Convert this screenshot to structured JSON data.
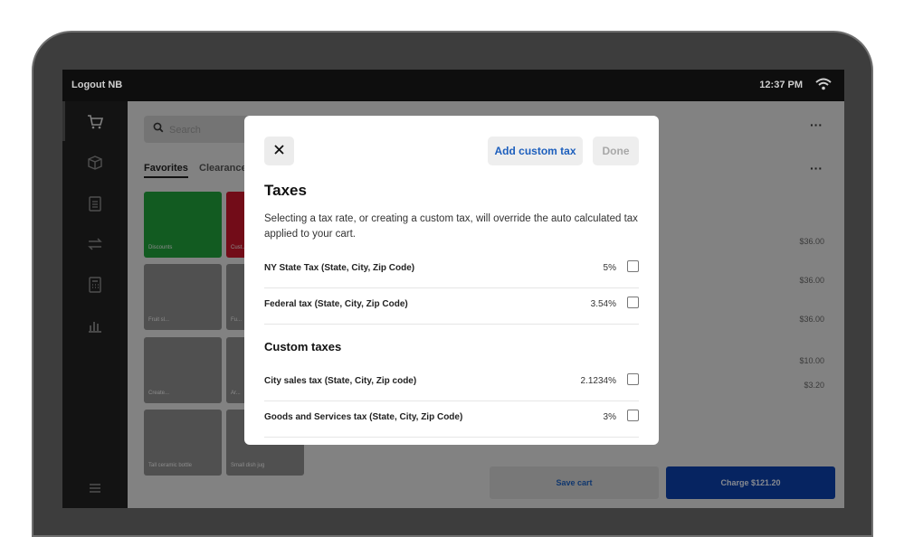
{
  "status_bar": {
    "user": "Logout NB",
    "time": "12:37 PM"
  },
  "background": {
    "search_placeholder": "Search",
    "tabs": [
      "Favorites",
      "Clearance"
    ],
    "tiles": [
      "Discounts",
      "Cust...",
      "Fruit sl...",
      "Fu...",
      "Create...",
      "Ar...",
      "Tall ceramic bottle",
      "Small dish jug"
    ],
    "amounts": [
      "$36.00",
      "$36.00",
      "$36.00",
      "$10.00",
      "$3.20"
    ],
    "save_cart": "Save cart",
    "charge": "Charge $121.20"
  },
  "dialog": {
    "add_custom_tax": "Add custom tax",
    "done": "Done",
    "title": "Taxes",
    "description": "Selecting a tax rate, or creating a custom tax, will override the auto calculated tax applied to your cart.",
    "taxes": [
      {
        "name": "NY State Tax (State, City, Zip Code)",
        "rate": "5%"
      },
      {
        "name": "Federal tax (State, City, Zip Code)",
        "rate": "3.54%"
      }
    ],
    "custom_heading": "Custom taxes",
    "custom_taxes": [
      {
        "name": "City sales tax (State, City, Zip code)",
        "rate": "2.1234%"
      },
      {
        "name": "Goods and Services tax (State, City, Zip Code)",
        "rate": "3%"
      }
    ]
  },
  "colors": {
    "accent": "#1d5fbd",
    "charge_button": "#0b3ea8",
    "discount_tile": "#1f9d3a",
    "red_tile": "#c4162a"
  }
}
